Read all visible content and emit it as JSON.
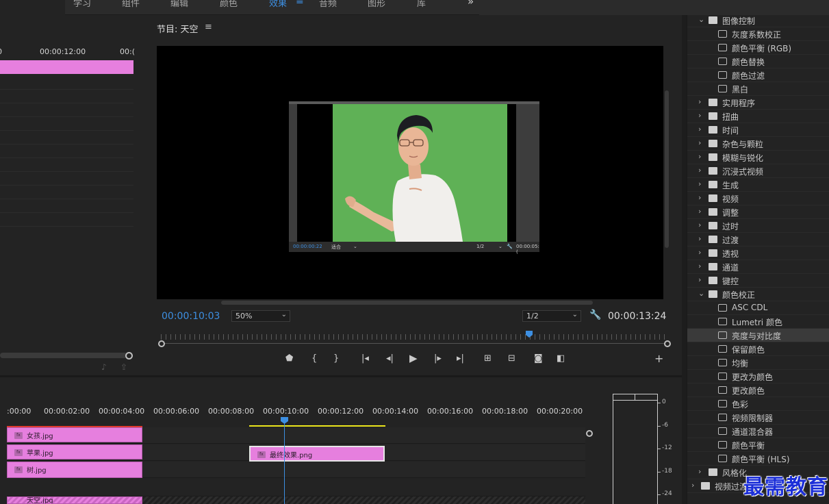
{
  "workspace": {
    "tabs": [
      {
        "label": "学习",
        "active": false
      },
      {
        "label": "组件",
        "active": false
      },
      {
        "label": "编辑",
        "active": false
      },
      {
        "label": "颜色",
        "active": false
      },
      {
        "label": "效果",
        "active": true
      },
      {
        "label": "音频",
        "active": false
      },
      {
        "label": "图形",
        "active": false
      },
      {
        "label": "库",
        "active": false
      }
    ],
    "menu_icon": "≡",
    "more_icon": "»"
  },
  "source": {
    "ruler": [
      "0",
      "00:00:12:00",
      "00:("
    ]
  },
  "program": {
    "title": "节目: 天空",
    "menu_icon": "≡",
    "current_timecode": "00:00:10:03",
    "zoom": "50%",
    "resolution": "1/2",
    "duration": "00:00:13:24",
    "nested": {
      "timecode": "00:00:00:22",
      "fit": "适合",
      "resolution": "1/2",
      "duration": "00:00:05:("
    }
  },
  "effects": {
    "items": [
      {
        "label": "图像控制",
        "type": "folder",
        "expanded": true,
        "level": 0
      },
      {
        "label": "灰度系数校正",
        "type": "effect",
        "level": 1
      },
      {
        "label": "颜色平衡 (RGB)",
        "type": "effect",
        "level": 1
      },
      {
        "label": "颜色替换",
        "type": "effect",
        "level": 1
      },
      {
        "label": "颜色过滤",
        "type": "effect",
        "level": 1
      },
      {
        "label": "黑白",
        "type": "effect",
        "level": 1
      },
      {
        "label": "实用程序",
        "type": "folder",
        "expanded": false,
        "level": 0
      },
      {
        "label": "扭曲",
        "type": "folder",
        "expanded": false,
        "level": 0
      },
      {
        "label": "时间",
        "type": "folder",
        "expanded": false,
        "level": 0
      },
      {
        "label": "杂色与颗粒",
        "type": "folder",
        "expanded": false,
        "level": 0
      },
      {
        "label": "模糊与锐化",
        "type": "folder",
        "expanded": false,
        "level": 0
      },
      {
        "label": "沉浸式视频",
        "type": "folder",
        "expanded": false,
        "level": 0
      },
      {
        "label": "生成",
        "type": "folder",
        "expanded": false,
        "level": 0
      },
      {
        "label": "视频",
        "type": "folder",
        "expanded": false,
        "level": 0
      },
      {
        "label": "调整",
        "type": "folder",
        "expanded": false,
        "level": 0
      },
      {
        "label": "过时",
        "type": "folder",
        "expanded": false,
        "level": 0
      },
      {
        "label": "过渡",
        "type": "folder",
        "expanded": false,
        "level": 0
      },
      {
        "label": "透视",
        "type": "folder",
        "expanded": false,
        "level": 0
      },
      {
        "label": "通道",
        "type": "folder",
        "expanded": false,
        "level": 0
      },
      {
        "label": "键控",
        "type": "folder",
        "expanded": false,
        "level": 0
      },
      {
        "label": "颜色校正",
        "type": "folder",
        "expanded": true,
        "level": 0
      },
      {
        "label": "ASC CDL",
        "type": "effect",
        "level": 1
      },
      {
        "label": "Lumetri 颜色",
        "type": "effect",
        "level": 1
      },
      {
        "label": "亮度与对比度",
        "type": "effect",
        "level": 1,
        "selected": true
      },
      {
        "label": "保留颜色",
        "type": "effect",
        "level": 1
      },
      {
        "label": "均衡",
        "type": "effect",
        "level": 1
      },
      {
        "label": "更改为颜色",
        "type": "effect",
        "level": 1
      },
      {
        "label": "更改颜色",
        "type": "effect",
        "level": 1
      },
      {
        "label": "色彩",
        "type": "effect",
        "level": 1
      },
      {
        "label": "视频限制器",
        "type": "effect",
        "level": 1
      },
      {
        "label": "通道混合器",
        "type": "effect",
        "level": 1
      },
      {
        "label": "颜色平衡",
        "type": "effect",
        "level": 1
      },
      {
        "label": "颜色平衡 (HLS)",
        "type": "effect",
        "level": 1
      },
      {
        "label": "风格化",
        "type": "folder",
        "expanded": false,
        "level": 0
      },
      {
        "label": "视频过渡",
        "type": "folder",
        "expanded": false,
        "level": -1
      }
    ]
  },
  "timeline": {
    "ruler": [
      ":00:00",
      "00:00:02:00",
      "00:00:04:00",
      "00:00:06:00",
      "00:00:08:00",
      "00:00:10:00",
      "00:00:12:00",
      "00:00:14:00",
      "00:00:16:00",
      "00:00:18:00",
      "00:00:20:00"
    ],
    "clips": [
      {
        "name": "女孩.jpg",
        "track": 0
      },
      {
        "name": "苹果.jpg",
        "track": 1
      },
      {
        "name": "树.jpg",
        "track": 2
      },
      {
        "name": "最终效果.png",
        "track": 1
      },
      {
        "name": "天空.jpg",
        "track": 4
      }
    ],
    "fx_label": "fx"
  },
  "meter": {
    "labels": [
      "0",
      "-6",
      "-12",
      "-18",
      "-24"
    ]
  },
  "watermark": "最需教育",
  "colors": {
    "accent": "#3d8fe2",
    "clip": "#e67fde",
    "inout": "#ebe51b",
    "green_screen": "#5fb156"
  }
}
